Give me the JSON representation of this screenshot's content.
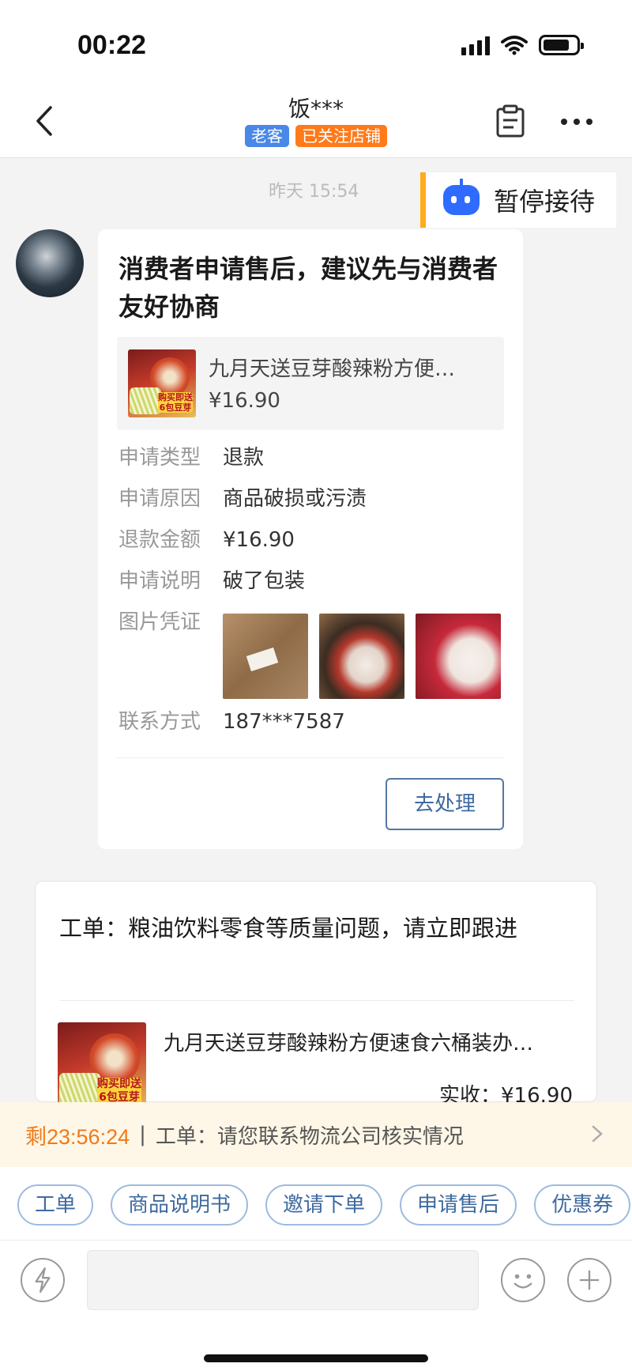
{
  "status_bar": {
    "time": "00:22"
  },
  "header": {
    "title": "饭***",
    "tags": [
      "老客",
      "已关注店铺"
    ]
  },
  "chat": {
    "timestamp": "昨天 15:54",
    "pause_button": "暂停接待",
    "after_sales_card": {
      "title": "消费者申请售后，建议先与消费者友好协商",
      "product": {
        "name": "九月天送豆芽酸辣粉方便…",
        "price": "¥16.90"
      },
      "thumb_badge": "购买即送 6包豆芽",
      "fields": [
        {
          "label": "申请类型",
          "value": "退款"
        },
        {
          "label": "申请原因",
          "value": "商品破损或污渍"
        },
        {
          "label": "退款金额",
          "value": "¥16.90"
        },
        {
          "label": "申请说明",
          "value": "破了包装"
        },
        {
          "label": "图片凭证",
          "value": ""
        },
        {
          "label": "联系方式",
          "value": "187***7587"
        }
      ],
      "action_button": "去处理"
    },
    "ticket_card": {
      "title": "工单：粮油饮料零食等质量问题，请立即跟进",
      "product_name": "九月天送豆芽酸辣粉方便速食六桶装办…",
      "paid": "实收：¥16.90"
    }
  },
  "notice": {
    "countdown": "剩23:56:24",
    "separator": "|",
    "text": "工单：请您联系物流公司核实情况"
  },
  "quick_actions": [
    "工单",
    "商品说明书",
    "邀请下单",
    "申请售后",
    "优惠券"
  ],
  "input": {
    "placeholder": ""
  },
  "colors": {
    "accent_orange": "#ff7a1a",
    "tag_blue": "#4a88e8",
    "link_blue": "#3f6aa0",
    "notice_bg": "#fef6e6",
    "pause_bar": "#ffab1a"
  }
}
